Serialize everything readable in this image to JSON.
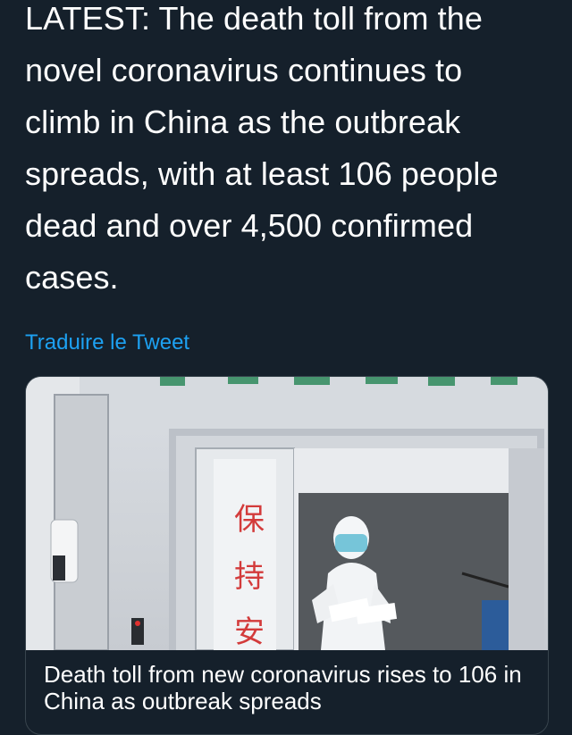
{
  "tweet": {
    "text": "LATEST: The death toll from the\nnovel coronavirus continues to\nclimb in China as the outbreak\nspreads, with at least 106 people\ndead and over 4,500 confirmed\ncases.",
    "translate_label": "Traduire le Tweet"
  },
  "card": {
    "image_sign_text": [
      "保",
      "持",
      "安"
    ],
    "title": "Death toll from new coronavirus rises to 106 in China as outbreak spreads"
  },
  "colors": {
    "background": "#15202b",
    "link": "#1da1f2"
  }
}
